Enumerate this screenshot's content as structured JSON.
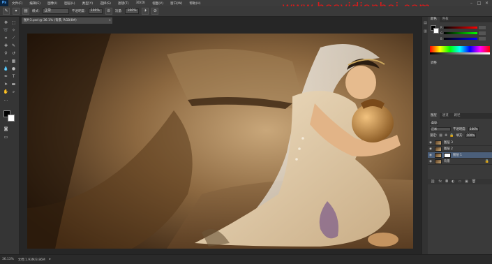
{
  "app": {
    "logo": "Ps"
  },
  "menu": {
    "items": [
      "文件(F)",
      "编辑(E)",
      "图像(I)",
      "图层(L)",
      "类型(Y)",
      "选择(S)",
      "滤镜(T)",
      "3D(D)",
      "视图(V)",
      "窗口(W)",
      "帮助(H)"
    ]
  },
  "watermark": "www.hasyidianhai.com",
  "window_controls": [
    "–",
    "□",
    "×"
  ],
  "options_bar": {
    "mode_label": "模式:",
    "mode_value": "正常",
    "opacity_label": "不透明度:",
    "opacity_value": "100%",
    "flow_label": "流量:",
    "flow_value": "100%"
  },
  "document": {
    "tab_title": "图片3.psd @ 36.1% (背景, RGB/8#)",
    "close": "×"
  },
  "status": {
    "zoom": "36.13%",
    "doc_size": "文档:1.93M/3.86M"
  },
  "panels": {
    "color_tabs": [
      "颜色",
      "色板"
    ],
    "slider_labels": [
      "R",
      "G",
      "B"
    ],
    "adjust_label": "调整",
    "layers_tabs": [
      "图层",
      "通道",
      "路径"
    ],
    "kind_label": "类型",
    "blend_mode": "正常",
    "opacity_label": "不透明度:",
    "opacity_value": "100%",
    "lock_label": "锁定:",
    "fill_label": "填充:",
    "fill_value": "100%",
    "layers": [
      {
        "name": "图层 3",
        "selected": false
      },
      {
        "name": "图层 2",
        "selected": false
      },
      {
        "name": "图层 1",
        "selected": true
      },
      {
        "name": "背景",
        "selected": false
      }
    ],
    "bottom_icons": [
      "link-icon",
      "fx-icon",
      "mask-icon",
      "adjustment-icon",
      "folder-icon",
      "new-layer-icon",
      "trash-icon"
    ]
  },
  "colors": {
    "watermark": "#d91b1b",
    "selection": "#4b5f7a"
  }
}
